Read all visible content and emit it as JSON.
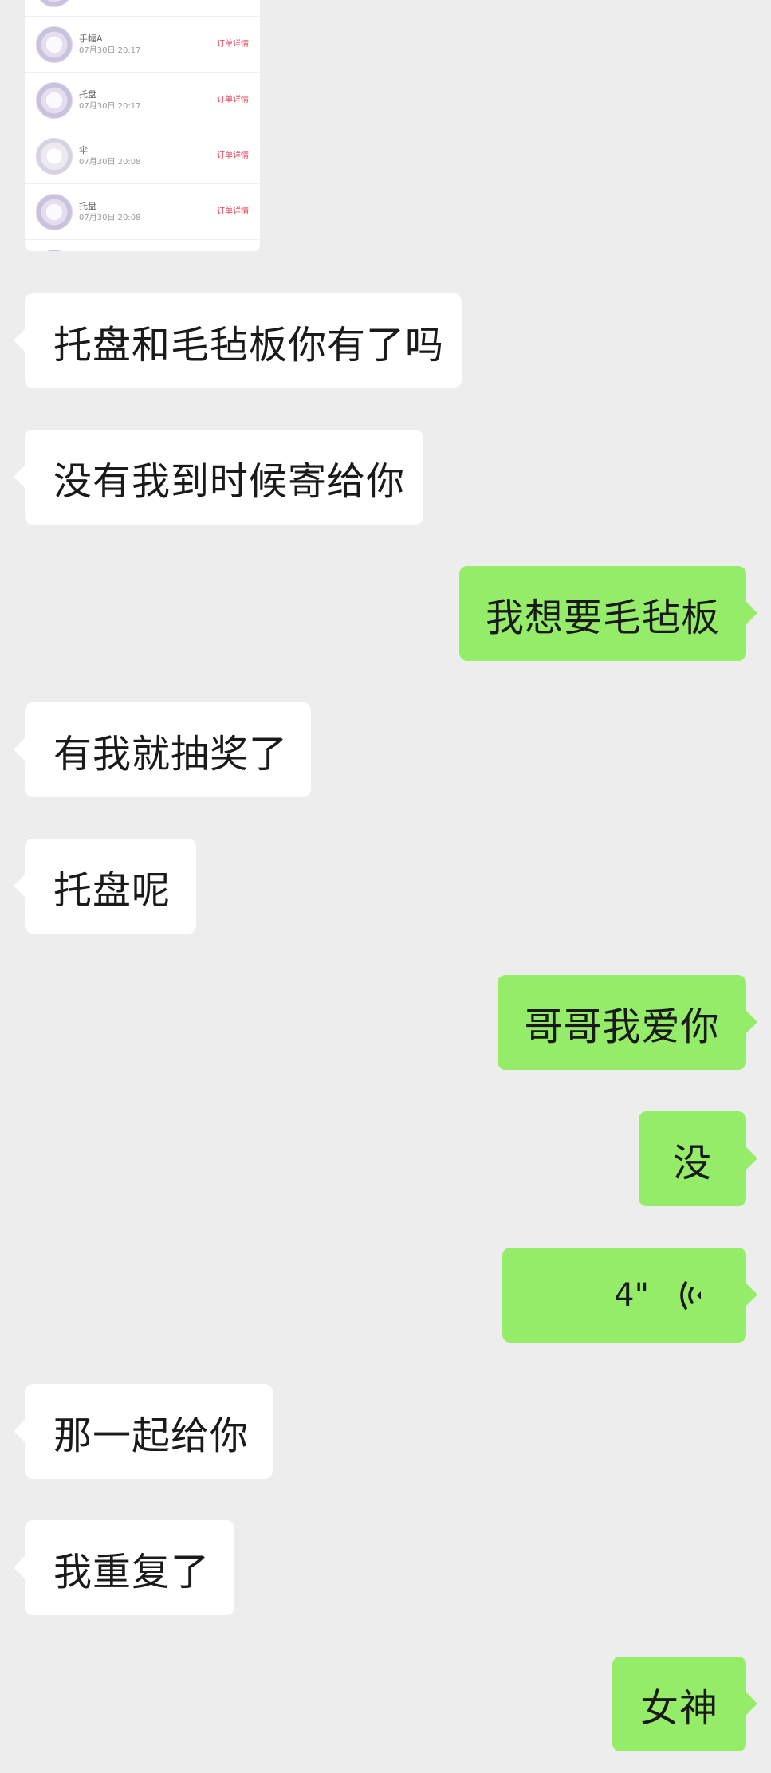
{
  "order_card": {
    "rows": [
      {
        "name": "手幅A",
        "time": "07月30日 20:17",
        "action": "订单详情"
      },
      {
        "name": "托盘",
        "time": "07月30日 20:17",
        "action": "订单详情"
      },
      {
        "name": "伞",
        "time": "07月30日 20:08",
        "action": "订单详情"
      },
      {
        "name": "托盘",
        "time": "07月30日 20:08",
        "action": "订单详情"
      }
    ]
  },
  "messages": [
    {
      "side": "in",
      "text": "托盘和毛毡板你有了吗"
    },
    {
      "side": "in",
      "text": "没有我到时候寄给你"
    },
    {
      "side": "out",
      "text": "我想要毛毡板"
    },
    {
      "side": "in",
      "text": "有我就抽奖了"
    },
    {
      "side": "in",
      "text": "托盘呢"
    },
    {
      "side": "out",
      "text": "哥哥我爱你"
    },
    {
      "side": "out",
      "text": "没"
    },
    {
      "side": "out",
      "type": "voice",
      "duration": "4\""
    },
    {
      "side": "in",
      "text": "那一起给你"
    },
    {
      "side": "in",
      "text": "我重复了"
    },
    {
      "side": "out",
      "text": "女神"
    }
  ],
  "colors": {
    "background": "#ededed",
    "incoming_bubble": "#ffffff",
    "outgoing_bubble": "#95ec69",
    "order_action": "#e0455a"
  },
  "icons": {
    "voice": "voice-wave-icon",
    "thumbnail": "product-thumbnail-icon"
  }
}
